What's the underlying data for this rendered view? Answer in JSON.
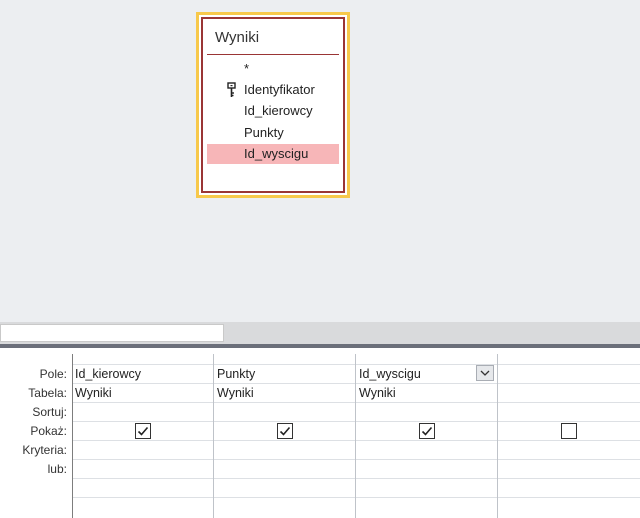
{
  "table_box": {
    "title": "Wyniki",
    "fields": [
      {
        "label": "*",
        "is_key": false,
        "selected": false
      },
      {
        "label": "Identyfikator",
        "is_key": true,
        "selected": false
      },
      {
        "label": "Id_kierowcy",
        "is_key": false,
        "selected": false
      },
      {
        "label": "Punkty",
        "is_key": false,
        "selected": false
      },
      {
        "label": "Id_wyscigu",
        "is_key": false,
        "selected": true
      }
    ]
  },
  "grid": {
    "row_labels": {
      "field": "Pole:",
      "table": "Tabela:",
      "sort": "Sortuj:",
      "show": "Pokaż:",
      "criteria": "Kryteria:",
      "or": "lub:"
    },
    "columns": [
      {
        "field": "Id_kierowcy",
        "table": "Wyniki",
        "show": true
      },
      {
        "field": "Punkty",
        "table": "Wyniki",
        "show": true
      },
      {
        "field": "Id_wyscigu",
        "table": "Wyniki",
        "show": true
      },
      {
        "field": "",
        "table": "",
        "show": false
      }
    ]
  },
  "colors": {
    "selection": "#f7b6b8",
    "table_border": "#9a3535",
    "focus_border": "#f7c84b"
  }
}
